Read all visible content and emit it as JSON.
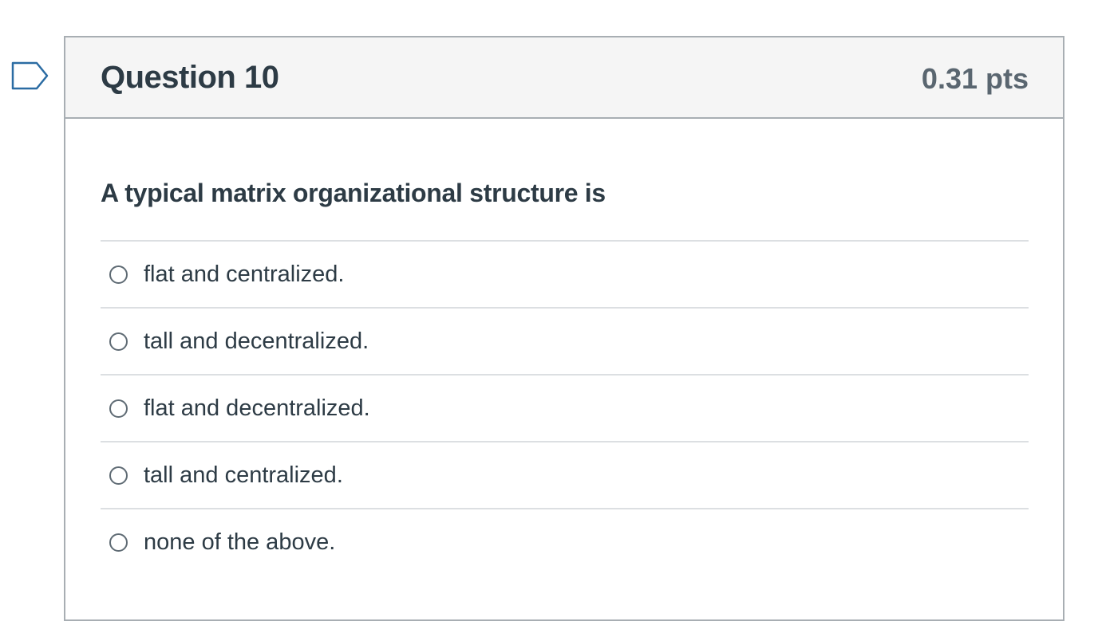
{
  "flag": {
    "icon": "flag-bookmark-icon",
    "color": "#2b6ca3"
  },
  "question": {
    "title": "Question 10",
    "points": "0.31 pts",
    "text": "A typical matrix organizational structure is",
    "answers": [
      {
        "label": "flat and centralized.",
        "selected": false
      },
      {
        "label": "tall and decentralized.",
        "selected": false
      },
      {
        "label": "flat and decentralized.",
        "selected": false
      },
      {
        "label": "tall and centralized.",
        "selected": false
      },
      {
        "label": "none of the above.",
        "selected": false
      }
    ]
  }
}
